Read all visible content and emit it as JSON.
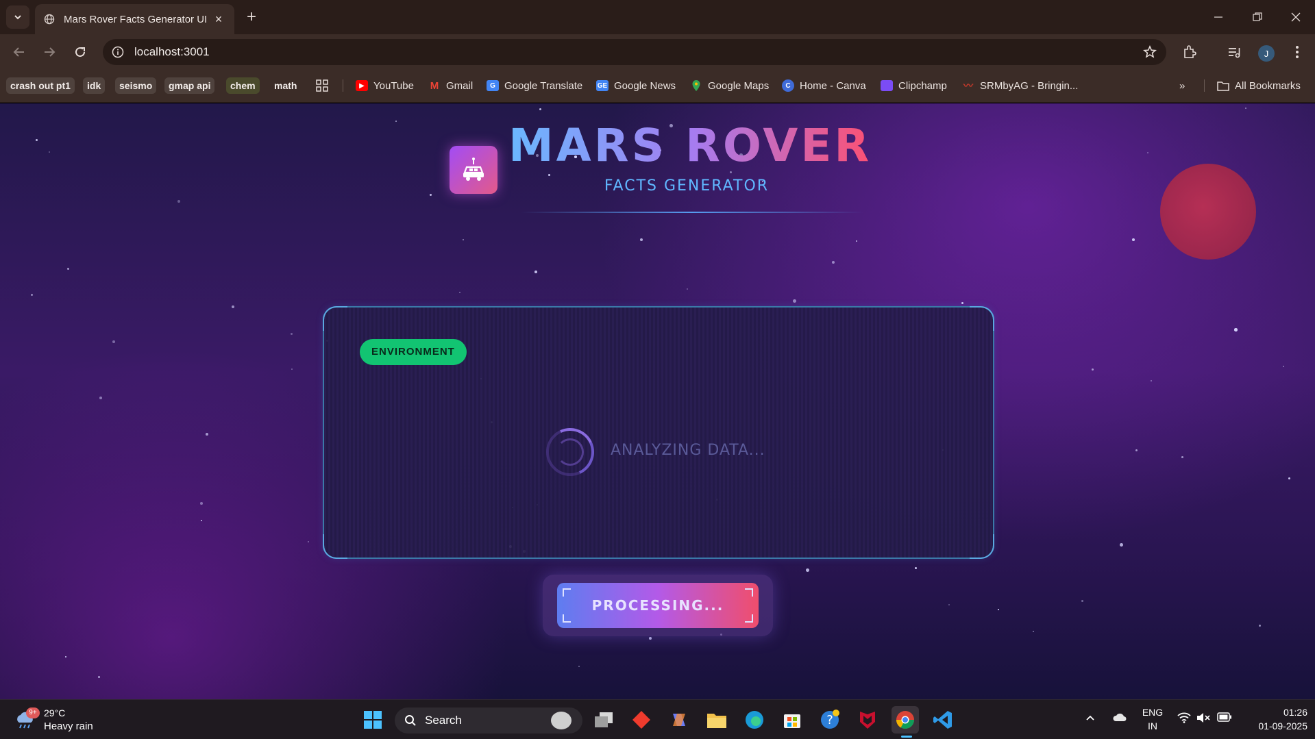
{
  "browser": {
    "tab_title": "Mars Rover Facts Generator UI",
    "url": "localhost:3001",
    "avatar_letter": "J",
    "bookmarks_chips": [
      "crash out pt1",
      "idk",
      "seismo",
      "gmap api",
      "chem",
      "math"
    ],
    "bookmarks": [
      {
        "label": "YouTube",
        "icon": "youtube-icon",
        "color": "#ff0000"
      },
      {
        "label": "Gmail",
        "icon": "gmail-icon",
        "color": "#ea4335"
      },
      {
        "label": "Google Translate",
        "icon": "google-translate-icon",
        "color": "#4285f4"
      },
      {
        "label": "Google News",
        "icon": "google-news-icon",
        "color": "#4285f4"
      },
      {
        "label": "Google Maps",
        "icon": "google-maps-icon",
        "color": "#34a853"
      },
      {
        "label": "Home - Canva",
        "icon": "canva-icon",
        "color": "#00c4cc"
      },
      {
        "label": "Clipchamp",
        "icon": "clipchamp-icon",
        "color": "#7b4cf5"
      },
      {
        "label": "SRMbyAG - Bringin...",
        "icon": "srm-icon",
        "color": "#c0392b"
      }
    ],
    "all_bookmarks": "All Bookmarks"
  },
  "app": {
    "title": "MARS ROVER",
    "subtitle": "FACTS GENERATOR",
    "category_badge": "ENVIRONMENT",
    "loading_text": "ANALYZING DATA...",
    "button_label": "PROCESSING...",
    "colors": {
      "badge": "#12c472",
      "title_gradient": [
        "#6ab8ff",
        "#a67cf0",
        "#ff4f6e"
      ],
      "card_border": "#3b79a8",
      "planet": "#b52a48"
    }
  },
  "taskbar": {
    "weather_temp": "29°C",
    "weather_desc": "Heavy rain",
    "weather_badge": "9+",
    "search_label": "Search",
    "lang_line1": "ENG",
    "lang_line2": "IN",
    "time": "01:26",
    "date": "01-09-2025"
  }
}
